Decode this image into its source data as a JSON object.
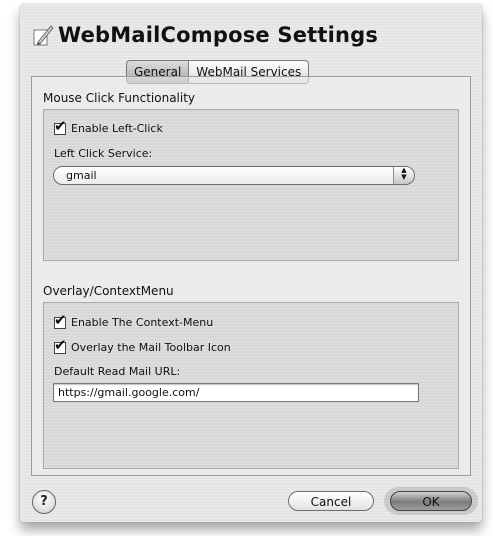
{
  "window": {
    "title": "WebMailCompose Settings"
  },
  "tabs": [
    {
      "label": "General",
      "selected": true
    },
    {
      "label": "WebMail Services",
      "selected": false
    }
  ],
  "mouse_section": {
    "title": "Mouse Click Functionality",
    "enable_left_click": {
      "label": "Enable Left-Click",
      "checked": true
    },
    "service_label": "Left Click Service:",
    "service_value": "gmail"
  },
  "overlay_section": {
    "title": "Overlay/ContextMenu",
    "enable_context_menu": {
      "label": "Enable The Context-Menu",
      "checked": true
    },
    "overlay_toolbar": {
      "label": "Overlay the Mail Toolbar Icon",
      "checked": true
    },
    "read_url_label": "Default Read Mail URL:",
    "read_url_value": "https://gmail.google.com/"
  },
  "footer": {
    "help_glyph": "?",
    "cancel_label": "Cancel",
    "ok_label": "OK"
  },
  "check_glyph": "✔"
}
